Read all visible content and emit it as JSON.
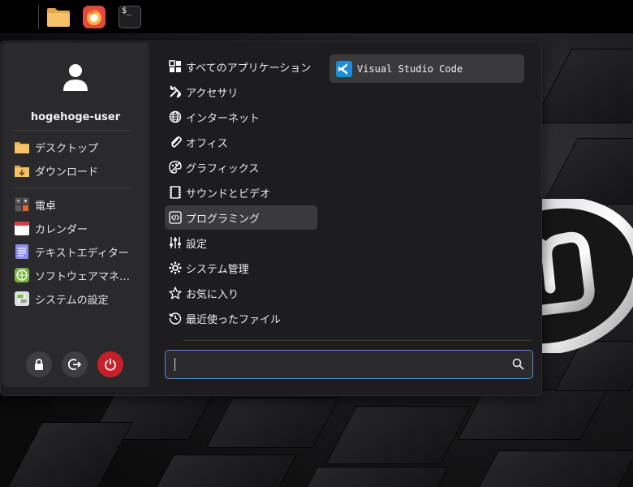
{
  "panel": {
    "launchers": [
      {
        "name": "menu-launcher",
        "icon": "linux-mint-icon"
      },
      {
        "name": "files-launcher",
        "icon": "folder-icon"
      },
      {
        "name": "firefox-launcher",
        "icon": "firefox-icon"
      },
      {
        "name": "terminal-launcher",
        "icon": "terminal-icon",
        "label": "$_"
      }
    ]
  },
  "user": {
    "name": "hogehoge-user",
    "icon": "user-avatar-icon"
  },
  "places": [
    {
      "label": "デスクトップ",
      "icon": "folder-icon"
    },
    {
      "label": "ダウンロード",
      "icon": "download-folder-icon"
    }
  ],
  "favorites": [
    {
      "label": "電卓",
      "icon": "calculator-icon"
    },
    {
      "label": "カレンダー",
      "icon": "calendar-icon"
    },
    {
      "label": "テキストエディター",
      "icon": "text-editor-icon"
    },
    {
      "label": "ソフトウェアマネ…",
      "icon": "software-manager-icon"
    },
    {
      "label": "システムの設定",
      "icon": "system-settings-icon"
    }
  ],
  "session_buttons": [
    {
      "name": "lock-screen-button",
      "icon": "lock-icon"
    },
    {
      "name": "logout-button",
      "icon": "logout-icon"
    },
    {
      "name": "power-button",
      "icon": "power-icon",
      "color": "#c8202a"
    }
  ],
  "categories": [
    {
      "label": "すべてのアプリケーション",
      "icon": "grid-icon",
      "active": false
    },
    {
      "label": "アクセサリ",
      "icon": "tools-icon",
      "active": false
    },
    {
      "label": "インターネット",
      "icon": "globe-icon",
      "active": false
    },
    {
      "label": "オフィス",
      "icon": "paperclip-icon",
      "active": false
    },
    {
      "label": "グラフィックス",
      "icon": "palette-icon",
      "active": false
    },
    {
      "label": "サウンドとビデオ",
      "icon": "film-icon",
      "active": false
    },
    {
      "label": "プログラミング",
      "icon": "code-icon",
      "active": true
    },
    {
      "label": "設定",
      "icon": "sliders-icon",
      "active": false
    },
    {
      "label": "システム管理",
      "icon": "gear-icon",
      "active": false
    },
    {
      "label": "お気に入り",
      "icon": "star-icon",
      "active": false
    },
    {
      "label": "最近使ったファイル",
      "icon": "history-icon",
      "active": false
    }
  ],
  "apps": [
    {
      "label": "Visual Studio Code",
      "icon": "vscode-icon"
    }
  ],
  "search": {
    "value": "",
    "placeholder": "",
    "icon": "search-icon"
  },
  "colors": {
    "accent": "#5b8fd6",
    "power": "#c8202a",
    "menu_bg": "#1d1d1f",
    "sidebar_bg": "#2a2a2c"
  }
}
